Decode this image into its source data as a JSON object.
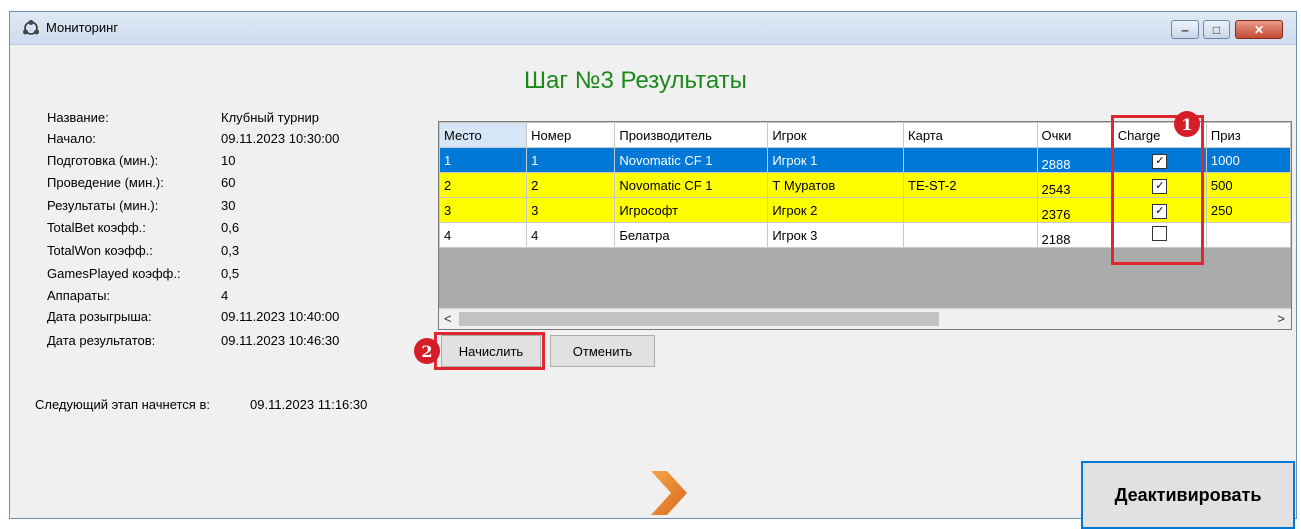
{
  "window": {
    "title": "Мониторинг",
    "controls": {
      "minimize": "‒",
      "maximize": "□",
      "close": "✕"
    }
  },
  "heading": "Шаг №3 Результаты",
  "info": [
    {
      "label": "Название:",
      "value": "Клубный турнир"
    },
    {
      "label": "Начало:",
      "value": "09.11.2023 10:30:00"
    },
    {
      "label": "Подготовка (мин.):",
      "value": "10"
    },
    {
      "label": "Проведение (мин.):",
      "value": "60"
    },
    {
      "label": "Результаты (мин.):",
      "value": "30"
    },
    {
      "label": "TotalBet коэфф.:",
      "value": "0,6"
    },
    {
      "label": "TotalWon коэфф.:",
      "value": "0,3"
    },
    {
      "label": "GamesPlayed коэфф.:",
      "value": "0,5"
    },
    {
      "label": "Аппараты:",
      "value": "4"
    },
    {
      "label": "Дата розыгрыша:",
      "value": "09.11.2023 10:40:00"
    },
    {
      "label": "Дата результатов:",
      "value": "09.11.2023 10:46:30"
    }
  ],
  "next_stage": {
    "label": "Следующий этап начнется в:",
    "value": "09.11.2023 11:16:30"
  },
  "grid": {
    "columns": [
      "Место",
      "Номер",
      "Производитель",
      "Игрок",
      "Карта",
      "Очки",
      "Charge",
      "Приз"
    ],
    "rows": [
      {
        "place": "1",
        "number": "1",
        "maker": "Novomatic CF 1",
        "player": "Игрок 1",
        "card": "",
        "points": "2888",
        "charge": true,
        "prize": "1000"
      },
      {
        "place": "2",
        "number": "2",
        "maker": "Novomatic CF 1",
        "player": "Т Муратов",
        "card": "TE-ST-2",
        "points": "2543",
        "charge": true,
        "prize": "500"
      },
      {
        "place": "3",
        "number": "3",
        "maker": "Игрософт",
        "player": "Игрок 2",
        "card": "",
        "points": "2376",
        "charge": true,
        "prize": "250"
      },
      {
        "place": "4",
        "number": "4",
        "maker": "Белатра",
        "player": "Игрок 3",
        "card": "",
        "points": "2188",
        "charge": false,
        "prize": ""
      }
    ],
    "scroll": {
      "left": "<",
      "right": ">"
    }
  },
  "buttons": {
    "accrue": "Начислить",
    "cancel": "Отменить",
    "deactivate": "Деактивировать"
  },
  "callouts": {
    "one": "1",
    "two": "2"
  },
  "colors": {
    "selected_row": "#0078d7",
    "highlight_row": "#ffff00",
    "heading": "#1a8a1a",
    "callout": "#e0262e",
    "next_arrow": "#e8822a"
  },
  "icons": {
    "app": "monitoring-app-icon",
    "next": "next-arrow-icon",
    "check": "☑"
  }
}
